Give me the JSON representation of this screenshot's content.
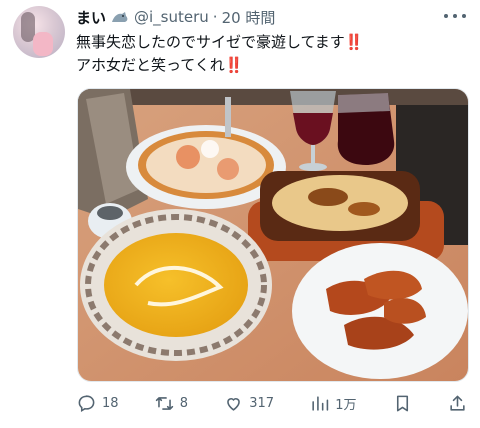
{
  "tweet": {
    "display_name": "まい",
    "handle": "@i_suteru",
    "dot": "·",
    "time": "20 時間",
    "text_line1": "無事失恋したのでサイゼで豪遊してます",
    "text_line2": "アホ女だと笑ってくれ",
    "emoji": "‼️"
  },
  "actions": {
    "replies": "18",
    "retweets": "8",
    "likes": "317",
    "views": "1万"
  },
  "colors": {
    "text": "#0f1419",
    "muted": "#536471",
    "emoji_red": "#e0245e"
  },
  "icons": [
    "badge-icon",
    "more-icon",
    "reply-icon",
    "retweet-icon",
    "like-icon",
    "views-icon",
    "bookmark-icon",
    "share-icon"
  ]
}
